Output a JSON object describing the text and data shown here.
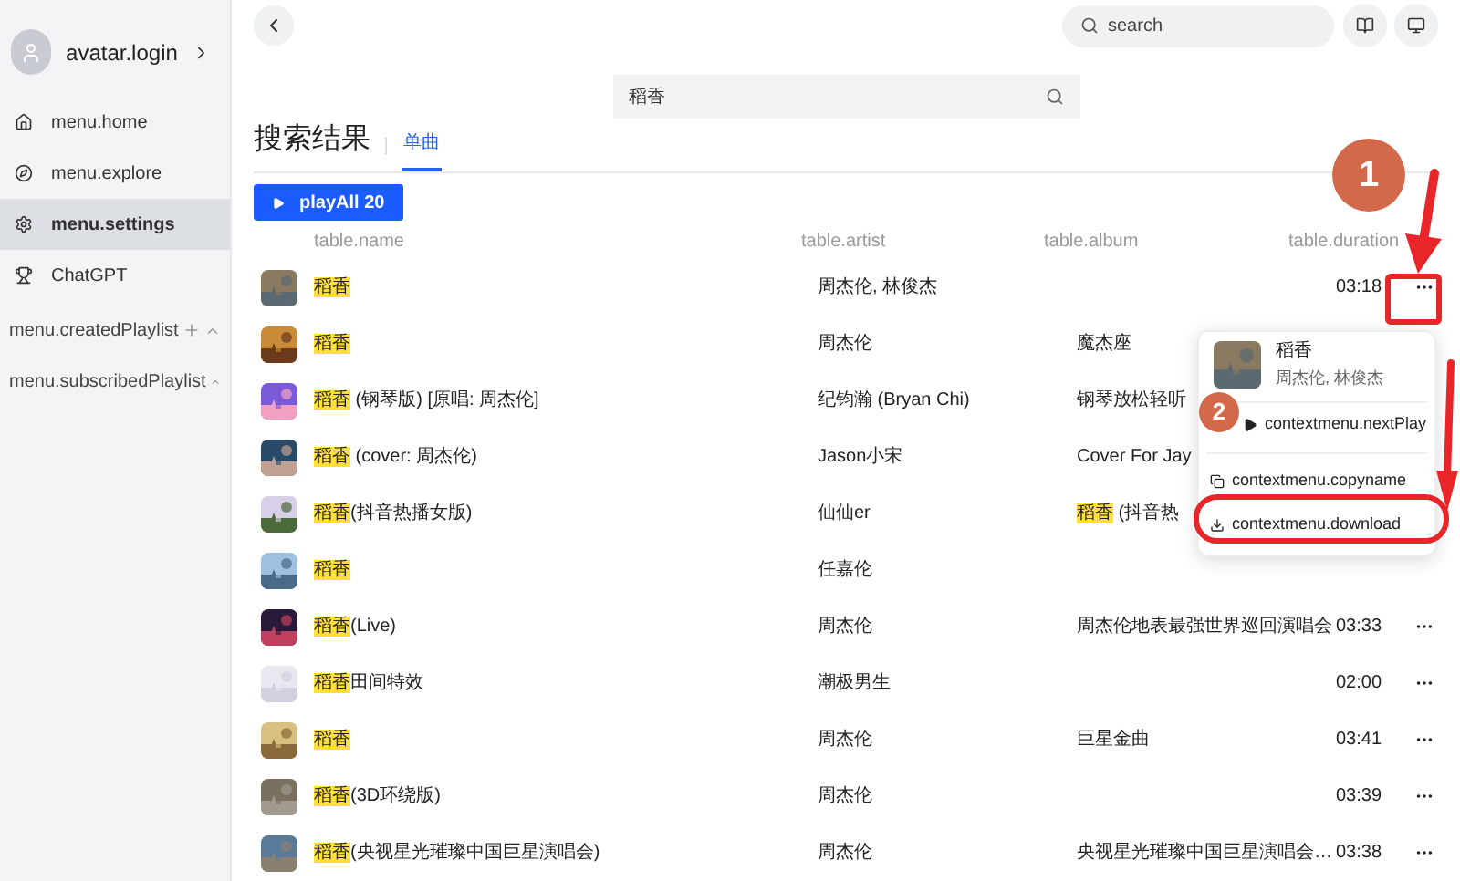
{
  "sidebar": {
    "user": {
      "label": "avatar.login"
    },
    "items": [
      {
        "label": "menu.home",
        "selected": false
      },
      {
        "label": "menu.explore",
        "selected": false
      },
      {
        "label": "menu.settings",
        "selected": true
      },
      {
        "label": "ChatGPT",
        "selected": false
      }
    ],
    "sections": [
      {
        "label": "menu.createdPlaylist",
        "add": true
      },
      {
        "label": "menu.subscribedPlaylist",
        "add": false
      }
    ]
  },
  "topbar": {
    "search": {
      "placeholder": "search"
    }
  },
  "search_box": {
    "value": "稻香"
  },
  "heading": "搜索结果",
  "tabs": [
    {
      "label": "单曲",
      "selected": true
    }
  ],
  "play_all": "playAll 20",
  "table": {
    "columns": [
      "table.name",
      "table.artist",
      "table.album",
      "table.duration"
    ],
    "rows": [
      {
        "name": {
          "match": "稻香"
        },
        "artist": "周杰伦, 林俊杰",
        "duration": "03:18",
        "more": true
      },
      {
        "name": {
          "match": "稻香"
        },
        "artist": "周杰伦",
        "album": {
          "rest": "魔杰座"
        }
      },
      {
        "name": {
          "match": "稻香",
          "rest": " (钢琴版) [原唱: 周杰伦]"
        },
        "artist": "纪钧瀚 (Bryan Chi)",
        "album": {
          "rest": "钢琴放松轻听"
        }
      },
      {
        "name": {
          "match": "稻香",
          "rest": " (cover: 周杰伦)"
        },
        "artist": "Jason小宋",
        "album": {
          "rest": "Cover For Jay"
        }
      },
      {
        "name": {
          "match": "稻香",
          "rest": "(抖音热播女版)"
        },
        "artist": "仙仙er",
        "album": {
          "match": "稻香",
          "rest": " (抖音热"
        }
      },
      {
        "name": {
          "match": "稻香"
        },
        "artist": "任嘉伦"
      },
      {
        "name": {
          "match": "稻香",
          "rest": "(Live)"
        },
        "artist": "周杰伦",
        "album": {
          "rest": "周杰伦地表最强世界巡回演唱会"
        },
        "duration": "03:33",
        "more": true
      },
      {
        "name": {
          "match": "稻香",
          "rest": "田间特效"
        },
        "artist": "潮极男生",
        "duration": "02:00",
        "more": true
      },
      {
        "name": {
          "match": "稻香"
        },
        "artist": "周杰伦",
        "album": {
          "rest": "巨星金曲"
        },
        "duration": "03:41",
        "more": true
      },
      {
        "name": {
          "match": "稻香",
          "rest": "(3D环绕版)"
        },
        "artist": "周杰伦",
        "duration": "03:39",
        "more": true
      },
      {
        "name": {
          "match": "稻香",
          "rest": "(央视星光璀璨中国巨星演唱会)"
        },
        "artist": "周杰伦",
        "album": {
          "rest": "央视星光璀璨中国巨星演唱会…"
        },
        "duration": "03:38",
        "more": true
      }
    ]
  },
  "context_menu": {
    "title": "稻香",
    "artist": "周杰伦, 林俊杰",
    "items": [
      {
        "label": "contextmenu.nextPlay"
      },
      {
        "label": "contextmenu.copyname"
      },
      {
        "label": "contextmenu.download"
      }
    ]
  },
  "annotations": [
    {
      "kind": "badge",
      "label": "1"
    },
    {
      "kind": "badge",
      "label": "2"
    }
  ]
}
